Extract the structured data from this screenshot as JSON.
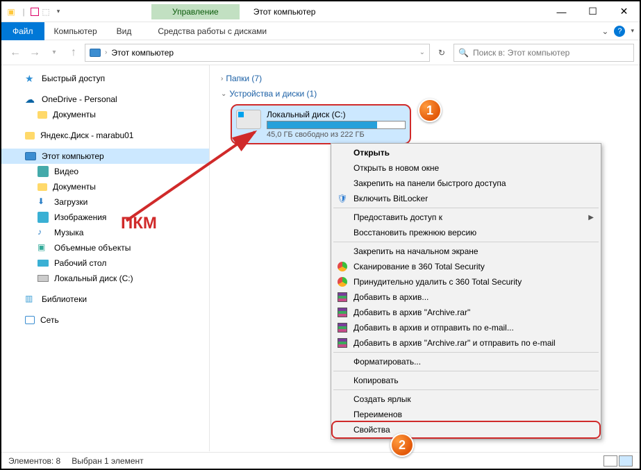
{
  "titlebar": {
    "contextual_tab": "Управление",
    "title": "Этот компьютер"
  },
  "menubar": {
    "file": "Файл",
    "computer": "Компьютер",
    "view": "Вид",
    "contextual": "Средства работы с дисками"
  },
  "address": {
    "location": "Этот компьютер"
  },
  "search": {
    "placeholder": "Поиск в: Этот компьютер"
  },
  "sidebar": {
    "quick_access": "Быстрый доступ",
    "onedrive": "OneDrive - Personal",
    "documents": "Документы",
    "yandex": "Яндекс.Диск - marabu01",
    "this_pc": "Этот компьютер",
    "videos": "Видео",
    "documents2": "Документы",
    "downloads": "Загрузки",
    "pictures": "Изображения",
    "music": "Музыка",
    "objects3d": "Объемные объекты",
    "desktop": "Рабочий стол",
    "drive_c": "Локальный диск (C:)",
    "libraries": "Библиотеки",
    "network": "Сеть"
  },
  "content": {
    "folders_header": "Папки (7)",
    "devices_header": "Устройства и диски (1)",
    "drive": {
      "name": "Локальный диск (C:)",
      "free": "45,0 ГБ свободно из 222 ГБ"
    }
  },
  "context_menu": {
    "open": "Открыть",
    "open_new": "Открыть в новом окне",
    "pin_quick": "Закрепить на панели быстрого доступа",
    "bitlocker": "Включить BitLocker",
    "give_access": "Предоставить доступ к",
    "restore": "Восстановить прежнюю версию",
    "pin_start": "Закрепить на начальном экране",
    "scan360": "Сканирование в 360 Total Security",
    "delete360": "Принудительно удалить с  360 Total Security",
    "add_archive": "Добавить в архив...",
    "add_archive_rar": "Добавить в архив \"Archive.rar\"",
    "add_email": "Добавить в архив и отправить по e-mail...",
    "add_rar_email": "Добавить в архив \"Archive.rar\" и отправить по e-mail",
    "format": "Форматировать...",
    "copy": "Копировать",
    "create_shortcut": "Создать ярлык",
    "rename": "Переименов",
    "properties": "Свойства"
  },
  "statusbar": {
    "count": "Элементов: 8",
    "selected": "Выбран 1 элемент"
  },
  "annotation": {
    "pkm": "ПКМ",
    "badge1": "1",
    "badge2": "2"
  }
}
